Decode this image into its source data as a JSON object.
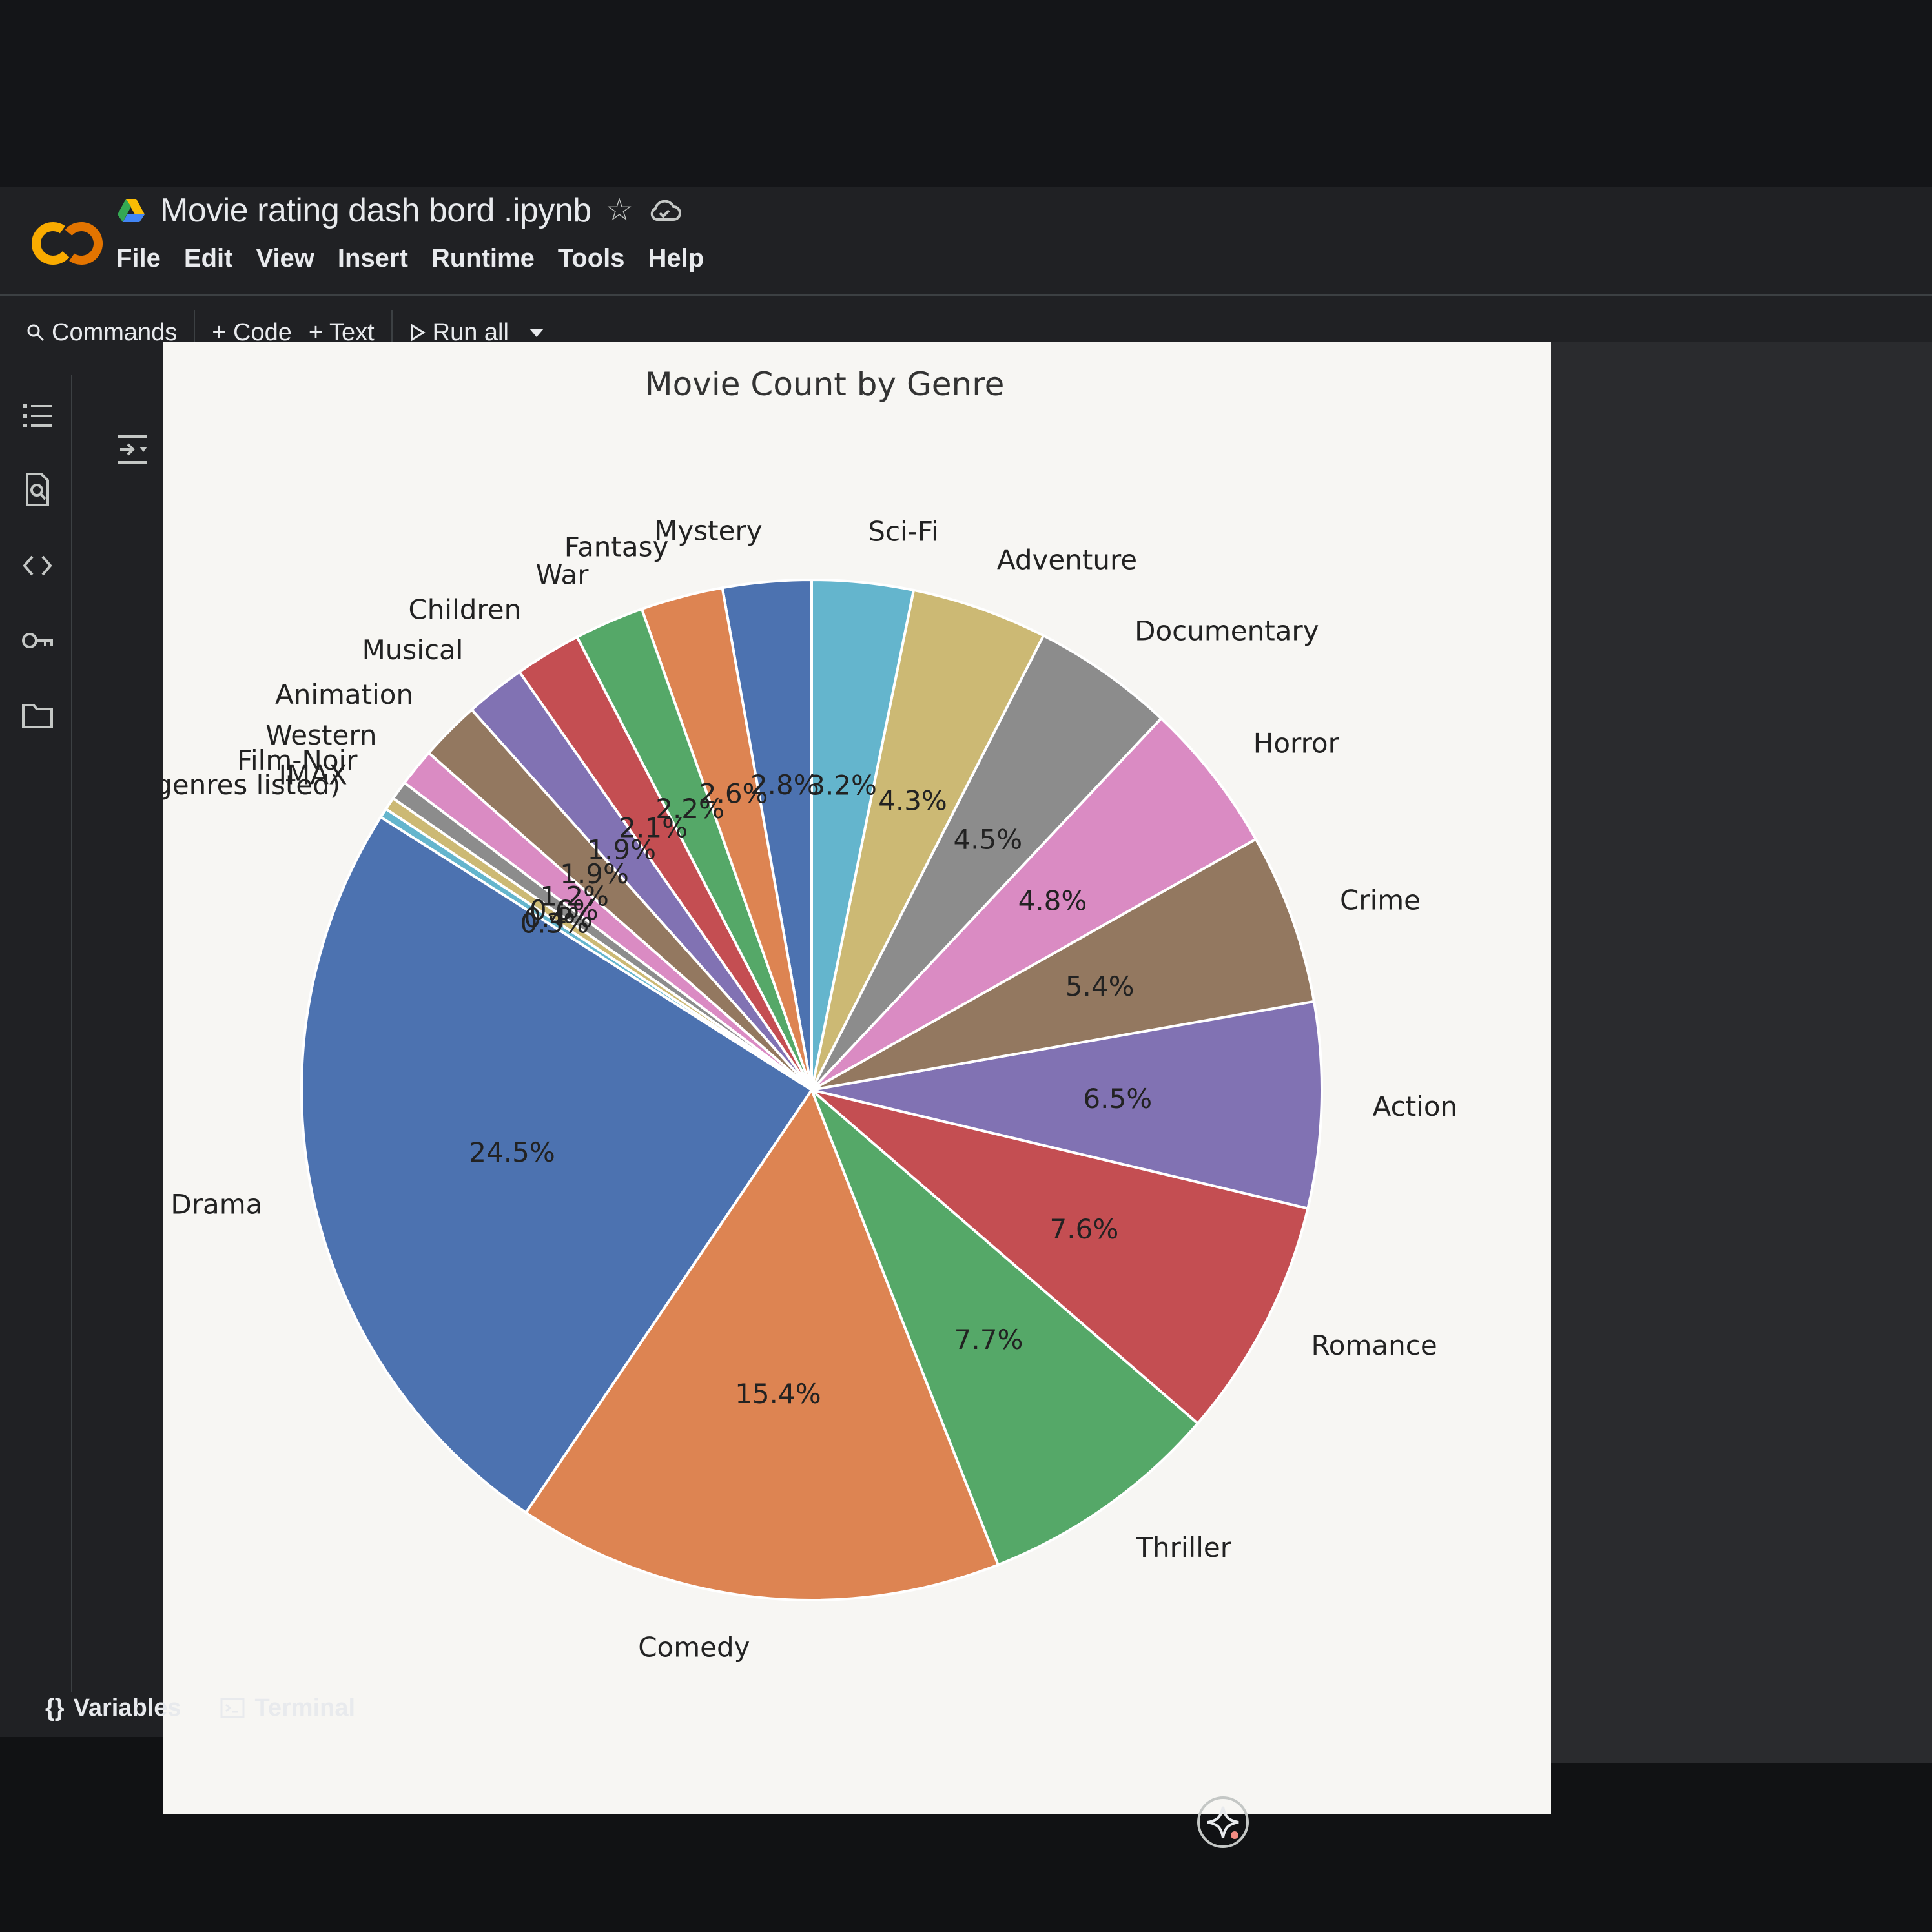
{
  "app": {
    "notebook_title": "Movie rating dash bord .ipynb",
    "logo_text": "CO"
  },
  "menu": [
    "File",
    "Edit",
    "View",
    "Insert",
    "Runtime",
    "Tools",
    "Help"
  ],
  "toolbar": {
    "commands": "Commands",
    "add_code": "+ Code",
    "add_text": "+ Text",
    "run_all": "Run all"
  },
  "statusbar": {
    "variables": "Variables",
    "terminal": "Terminal"
  },
  "colors": {
    "logo": "#f9ab00",
    "accent": "#1a73e8",
    "panel": "#202124"
  },
  "icons": {
    "rail": [
      "table-of-contents-icon",
      "find-icon",
      "code-snippets-icon",
      "secrets-key-icon",
      "files-folder-icon"
    ]
  },
  "chart_data": {
    "type": "pie",
    "title": "Movie Count by Genre",
    "start_angle_deg": 90,
    "direction": "counterclockwise",
    "slices": [
      {
        "label": "Mystery",
        "value": 2.8,
        "pct_label": "2.8%",
        "color": "#4c72b0"
      },
      {
        "label": "Fantasy",
        "value": 2.6,
        "pct_label": "2.6%",
        "color": "#dd8452"
      },
      {
        "label": "War",
        "value": 2.2,
        "pct_label": "2.2%",
        "color": "#55a868"
      },
      {
        "label": "Children",
        "value": 2.1,
        "pct_label": "2.1%",
        "color": "#c44e52"
      },
      {
        "label": "Musical",
        "value": 1.9,
        "pct_label": "1.9%",
        "color": "#8172b3"
      },
      {
        "label": "Animation",
        "value": 1.9,
        "pct_label": "1.9%",
        "color": "#937860"
      },
      {
        "label": "Western",
        "value": 1.2,
        "pct_label": "1.2%",
        "color": "#da8bc3"
      },
      {
        "label": "Film-Noir",
        "value": 0.6,
        "pct_label": "0.6%",
        "color": "#8c8c8c"
      },
      {
        "label": "IMAX",
        "value": 0.4,
        "pct_label": "0.4%",
        "color": "#ccb974"
      },
      {
        "label": "(no genres listed)",
        "value": 0.3,
        "pct_label": "0.3%",
        "color": "#64b5cd"
      },
      {
        "label": "Drama",
        "value": 24.5,
        "pct_label": "24.5%",
        "color": "#4c72b0"
      },
      {
        "label": "Comedy",
        "value": 15.4,
        "pct_label": "15.4%",
        "color": "#dd8452"
      },
      {
        "label": "Thriller",
        "value": 7.7,
        "pct_label": "7.7%",
        "color": "#55a868"
      },
      {
        "label": "Romance",
        "value": 7.6,
        "pct_label": "7.6%",
        "color": "#c44e52"
      },
      {
        "label": "Action",
        "value": 6.5,
        "pct_label": "6.5%",
        "color": "#8172b3"
      },
      {
        "label": "Crime",
        "value": 5.4,
        "pct_label": "5.4%",
        "color": "#937860"
      },
      {
        "label": "Horror",
        "value": 4.8,
        "pct_label": "4.8%",
        "color": "#da8bc3"
      },
      {
        "label": "Documentary",
        "value": 4.5,
        "pct_label": "4.5%",
        "color": "#8c8c8c"
      },
      {
        "label": "Adventure",
        "value": 4.3,
        "pct_label": "4.3%",
        "color": "#ccb974"
      },
      {
        "label": "Sci-Fi",
        "value": 3.2,
        "pct_label": "3.2%",
        "color": "#64b5cd"
      }
    ]
  }
}
